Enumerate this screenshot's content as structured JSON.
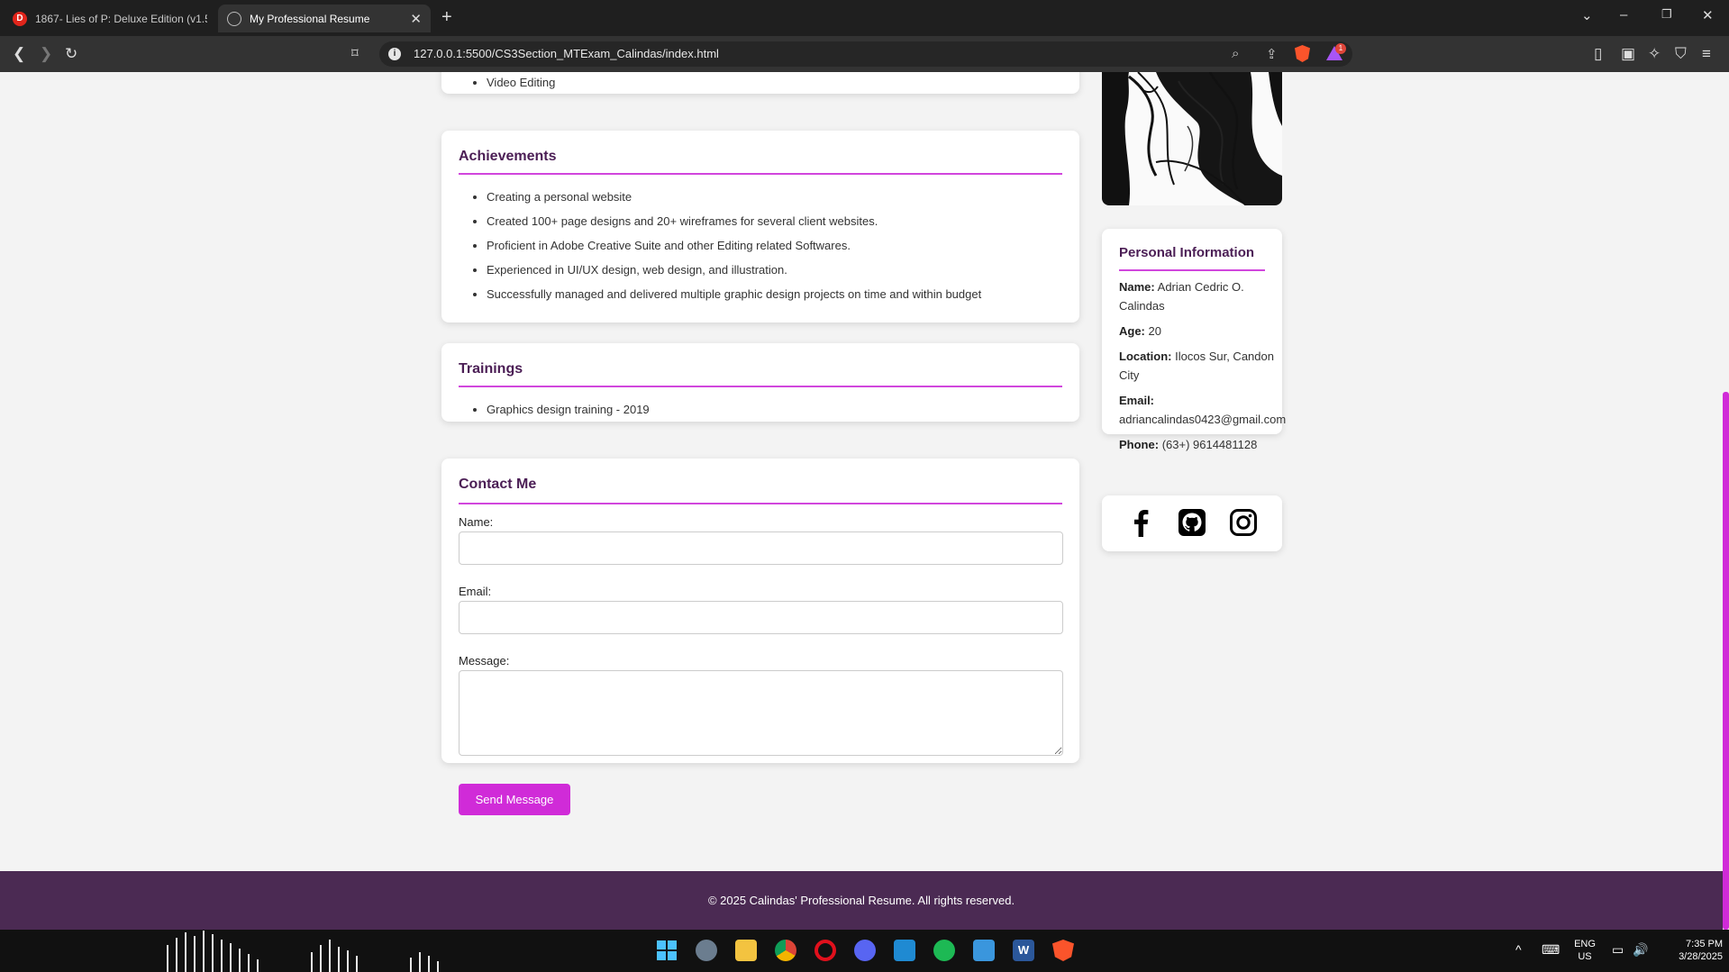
{
  "browser": {
    "tabs": [
      {
        "title": "1867- Lies of P: Deluxe Edition (v1.5"
      },
      {
        "title": "My Professional Resume"
      }
    ],
    "url": "127.0.0.1:5500/CS3Section_MTExam_Calindas/index.html",
    "rewards_badge": "1"
  },
  "skills_tail": {
    "items": [
      "Video Editing"
    ]
  },
  "achievements": {
    "heading": "Achievements",
    "items": [
      "Creating a personal website",
      "Created 100+ page designs and 20+ wireframes for several client websites.",
      "Proficient in Adobe Creative Suite and other Editing related Softwares.",
      "Experienced in UI/UX design, web design, and illustration.",
      "Successfully managed and delivered multiple graphic design projects on time and within budget"
    ]
  },
  "trainings": {
    "heading": "Trainings",
    "items": [
      "Graphics design training - 2019"
    ]
  },
  "contact": {
    "heading": "Contact Me",
    "name_label": "Name:",
    "name_value": "",
    "email_label": "Email:",
    "email_value": "",
    "message_label": "Message:",
    "message_value": "",
    "button_label": "Send Message"
  },
  "personal_info": {
    "heading": "Personal Information",
    "name_label": "Name:",
    "name_value": "Adrian Cedric O. Calindas",
    "age_label": "Age:",
    "age_value": "20",
    "location_label": "Location:",
    "location_value": "Ilocos Sur, Candon City",
    "email_label": "Email:",
    "email_value": "adriancalindas0423@gmail.com",
    "phone_label": "Phone:",
    "phone_value": "(63+) 9614481128"
  },
  "social": [
    "facebook-icon",
    "github-icon",
    "instagram-icon"
  ],
  "footer": {
    "text": "© 2025 Calindas' Professional Resume. All rights reserved."
  },
  "taskbar": {
    "lang_top": "ENG",
    "lang_bottom": "US",
    "time": "7:35 PM",
    "date": "3/28/2025"
  },
  "colors": {
    "accent": "#d02bd8",
    "heading": "#4b1e55",
    "footer": "#4b2a53"
  }
}
